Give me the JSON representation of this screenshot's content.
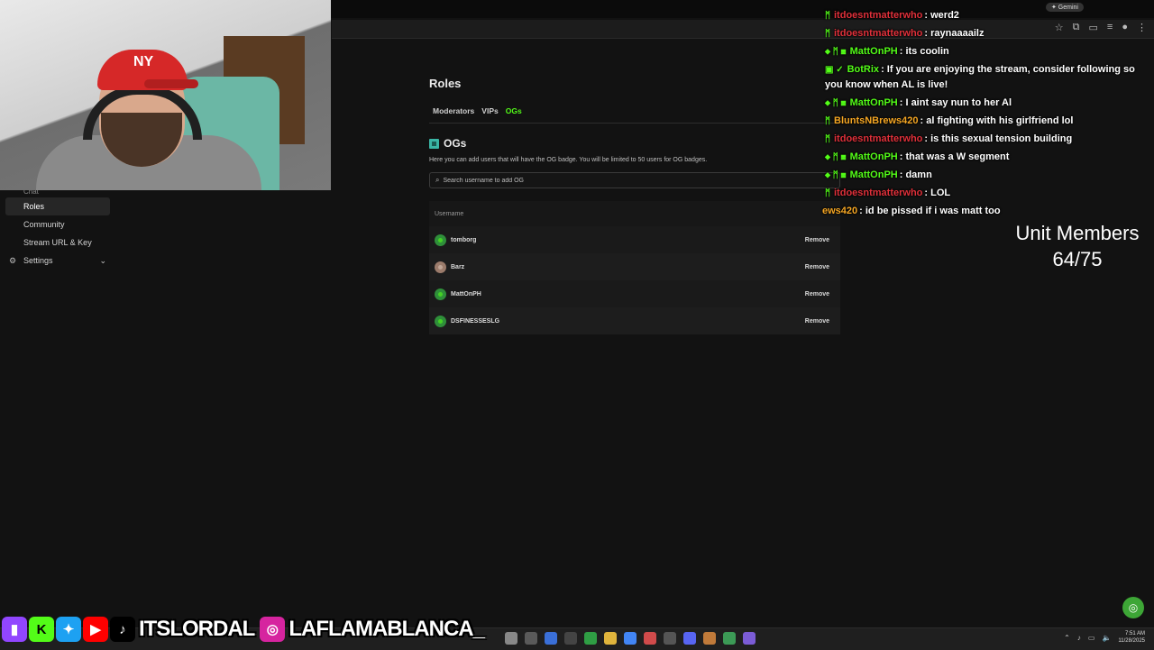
{
  "browser": {
    "gemini_label": "✦ Gemini"
  },
  "sidebar": {
    "partial_item": "Chat",
    "items": [
      {
        "label": "Roles",
        "active": true
      },
      {
        "label": "Community",
        "active": false
      },
      {
        "label": "Stream URL & Key",
        "active": false
      },
      {
        "label": "Settings",
        "active": false,
        "icon": "gear-icon",
        "expandable": true
      }
    ]
  },
  "main": {
    "title": "Roles",
    "tabs": [
      {
        "label": "Moderators",
        "active": false
      },
      {
        "label": "VIPs",
        "active": false
      },
      {
        "label": "OGs",
        "active": true
      }
    ],
    "section_title": "OGs",
    "section_desc": "Here you can add users that will have the OG badge. You will be limited to 50 users for OG badges.",
    "search_placeholder": "Search username to add OG",
    "table_header": "Username",
    "remove_label": "Remove",
    "users": [
      {
        "name": "tomborg",
        "avatar": "green"
      },
      {
        "name": "Barz",
        "avatar": "photo"
      },
      {
        "name": "MattOnPH",
        "avatar": "green"
      },
      {
        "name": "DSFINESSESLG",
        "avatar": "green"
      }
    ]
  },
  "chat": {
    "messages": [
      {
        "user": "itdoesntmatterwho",
        "text": ": werd2",
        "color": "#e0303a",
        "badges": "ᛗ"
      },
      {
        "user": "itdoesntmatterwho",
        "text": ": raynaaaailz",
        "color": "#e0303a",
        "badges": "ᛗ"
      },
      {
        "user": "MattOnPH",
        "text": ": its coolin",
        "color": "#53fc18",
        "badges": "◆ ᛗ ▦"
      },
      {
        "user": "BotRix",
        "text": ": If you are enjoying the stream, consider following so you know when AL is live!",
        "color": "#53fc18",
        "badges": "▣ ✓"
      },
      {
        "user": "MattOnPH",
        "text": ": I aint say nun to her Al",
        "color": "#53fc18",
        "badges": "◆ ᛗ ▦"
      },
      {
        "user": "BluntsNBrews420",
        "text": ": al fighting with his girlfriend lol",
        "color": "#f5a623",
        "badges": "ᛗ"
      },
      {
        "user": "itdoesntmatterwho",
        "text": ": is this sexual tension building",
        "color": "#e0303a",
        "badges": "ᛗ"
      },
      {
        "user": "MattOnPH",
        "text": ": that was a W segment",
        "color": "#53fc18",
        "badges": "◆ ᛗ ▦"
      },
      {
        "user": "MattOnPH",
        "text": ": damn",
        "color": "#53fc18",
        "badges": "◆ ᛗ ▦"
      },
      {
        "user": "itdoesntmatterwho",
        "text": ": LOL",
        "color": "#e0303a",
        "badges": "ᛗ"
      },
      {
        "user": "ews420",
        "text": ": id be pissed if i was matt too",
        "color": "#f5a623",
        "badges": ""
      }
    ]
  },
  "overlay": {
    "members_label": "Unit Members",
    "members_count": "64/75",
    "handle_1": "ITSLORDAL",
    "handle_2": "LAFLAMABLANCA_",
    "cap_logo": "NY"
  },
  "taskbar": {
    "time": "7:51 AM",
    "date": "11/28/2025"
  }
}
